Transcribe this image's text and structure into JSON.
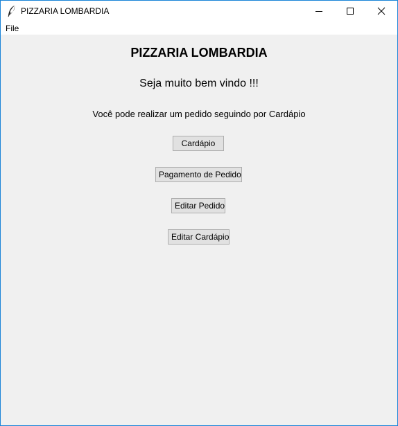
{
  "window": {
    "title": "PIZZARIA LOMBARDIA",
    "icon": "feather-icon"
  },
  "menu": {
    "file_label": "File"
  },
  "main": {
    "heading": "PIZZARIA LOMBARDIA",
    "welcome": "Seja muito bem vindo !!!",
    "instructions": "Você pode realizar um pedido seguindo por Cardápio",
    "buttons": {
      "cardapio": "Cardápio",
      "pagamento": "Pagamento de Pedido",
      "editar_pedido": "Editar Pedido",
      "editar_cardapio": "Editar Cardápio"
    }
  },
  "colors": {
    "window_border": "#1883d7",
    "background": "#f0f0f0",
    "button_face": "#e1e1e1",
    "button_border": "#adadad"
  }
}
